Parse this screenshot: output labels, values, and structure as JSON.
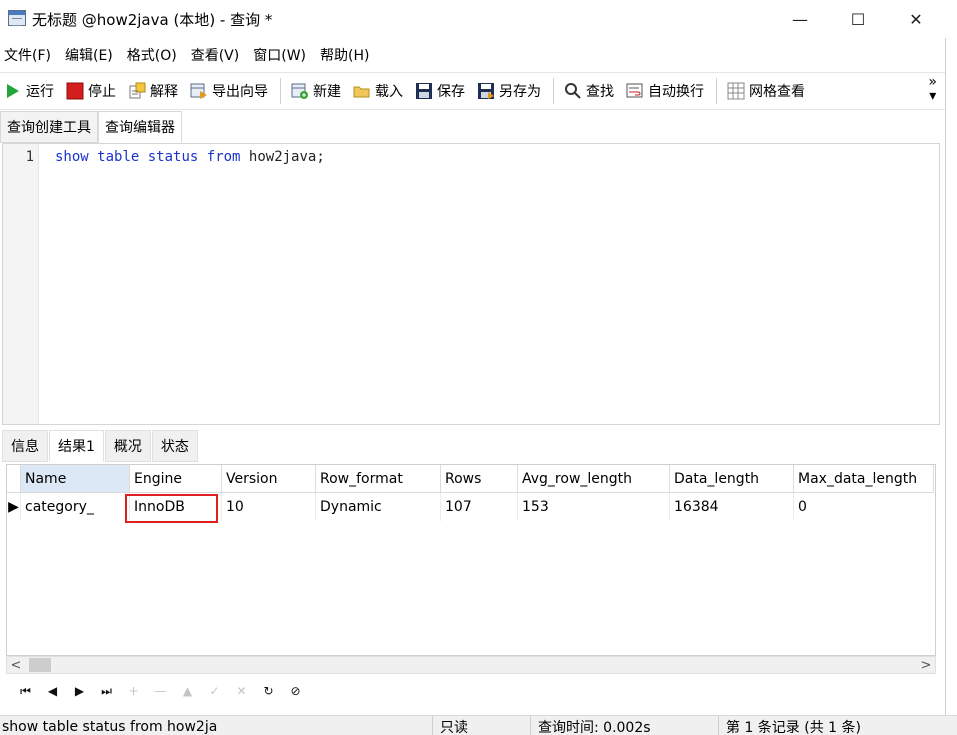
{
  "window": {
    "title": "无标题 @how2java (本地) - 查询 *",
    "minimize": "—",
    "maximize": "☐",
    "close": "✕"
  },
  "menu": [
    "文件(F)",
    "编辑(E)",
    "格式(O)",
    "查看(V)",
    "窗口(W)",
    "帮助(H)"
  ],
  "toolbar": {
    "run": "运行",
    "stop": "停止",
    "explain": "解释",
    "export_wizard": "导出向导",
    "new": "新建",
    "load": "载入",
    "save": "保存",
    "save_as": "另存为",
    "find": "查找",
    "word_wrap": "自动换行",
    "grid_view": "网格查看",
    "more": "»",
    "dropdown": "▾"
  },
  "editor_tabs": [
    "查询创建工具",
    "查询编辑器"
  ],
  "editor": {
    "line_number": "1",
    "code": {
      "kw1": "show",
      "kw2": "table",
      "kw3": "status",
      "kw4": "from",
      "rest": " how2java;"
    }
  },
  "result_tabs": [
    "信息",
    "结果1",
    "概况",
    "状态"
  ],
  "grid": {
    "columns": [
      "Name",
      "Engine",
      "Version",
      "Row_format",
      "Rows",
      "Avg_row_length",
      "Data_length",
      "Max_data_length"
    ],
    "rows": [
      {
        "indicator": "▶",
        "cells": [
          "category_",
          "InnoDB",
          "10",
          "Dynamic",
          "107",
          "153",
          "16384",
          "0"
        ]
      }
    ]
  },
  "scroll": {
    "left": "<",
    "right": ">"
  },
  "nav": [
    "⏮",
    "◀",
    "▶",
    "⏭",
    "+",
    "—",
    "▲",
    "✓",
    "✕",
    "↻",
    "⊘"
  ],
  "status": {
    "query": "show table status from how2ja",
    "mode": "只读",
    "time": "查询时间: 0.002s",
    "records": "第 1 条记录 (共 1 条)"
  },
  "colors": {
    "keyword": "#1a33cc",
    "highlight": "#e02020",
    "selected_header": "#dce8f5"
  }
}
